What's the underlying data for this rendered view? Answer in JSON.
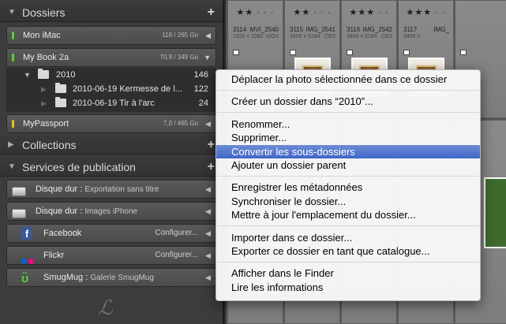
{
  "sidebar": {
    "dossiers_title": "Dossiers",
    "volumes": [
      {
        "name": "Mon iMac",
        "size": "116 / 265 Go",
        "led": "#5ad12e"
      },
      {
        "name": "My Book 2a",
        "size": "70,9 / 349 Go",
        "led": "#5ad12e"
      },
      {
        "name": "MyPassport",
        "size": "7,0 / 465 Go",
        "led": "#e8c416"
      }
    ],
    "folders": [
      {
        "name": "2010",
        "count": "146"
      },
      {
        "name": "2010-06-19 Kermesse de l...",
        "count": "122"
      },
      {
        "name": "2010-06-19 Tir à l'arc",
        "count": "24"
      }
    ],
    "collections_title": "Collections",
    "services_title": "Services de publication",
    "services": [
      {
        "name": "Disque dur :",
        "sub": "Exportation sans titre",
        "cfg": ""
      },
      {
        "name": "Disque dur :",
        "sub": "Images iPhone",
        "cfg": ""
      },
      {
        "name": "Facebook",
        "sub": "",
        "cfg": "Configurer..."
      },
      {
        "name": "Flickr",
        "sub": "",
        "cfg": "Configurer..."
      },
      {
        "name": "SmugMug :",
        "sub": "Galerie SmugMug",
        "cfg": ""
      }
    ]
  },
  "grid": {
    "cells": [
      {
        "stars": "★★ · · ·",
        "num": "3114",
        "file": "MVI_2540",
        "dim": "1920 x 1080",
        "ext": "MOV"
      },
      {
        "stars": "★★ · · ·",
        "num": "3115",
        "file": "IMG_2541",
        "dim": "3456 x 5184",
        "ext": "CR2"
      },
      {
        "stars": "★★★ · ·",
        "num": "3116",
        "file": "IMG_2542",
        "dim": "3456 x 5184",
        "ext": "CR2"
      },
      {
        "stars": "★★★ · ·",
        "num": "3117",
        "file": "IMG_",
        "dim": "3456 x",
        "ext": ""
      }
    ]
  },
  "menu": {
    "groups": [
      [
        "Déplacer la photo sélectionnée dans ce dossier"
      ],
      [
        "Créer un dossier dans “2010”..."
      ],
      [
        "Renommer...",
        "Supprimer...",
        "Convertir les sous-dossiers",
        "Ajouter un dossier parent"
      ],
      [
        "Enregistrer les métadonnées",
        "Synchroniser le dossier...",
        "Mettre à jour l'emplacement du dossier..."
      ],
      [
        "Importer dans ce dossier...",
        "Exporter ce dossier en tant que catalogue..."
      ],
      [
        "Afficher dans le Finder",
        "Lire les informations"
      ]
    ],
    "highlighted": "Convertir les sous-dossiers"
  },
  "icons": {
    "plus": "plus-icon",
    "triangle": "disclosure-triangle-icon",
    "folder": "folder-icon",
    "facebook": "facebook-icon",
    "flickr": "flickr-icon",
    "smugmug": "smugmug-icon",
    "disk": "hard-disk-icon",
    "logo": "lightroom-logo"
  },
  "colors": {
    "highlight": "#3f66c8",
    "flickr_blue": "#0063dc",
    "flickr_pink": "#ff0084"
  }
}
